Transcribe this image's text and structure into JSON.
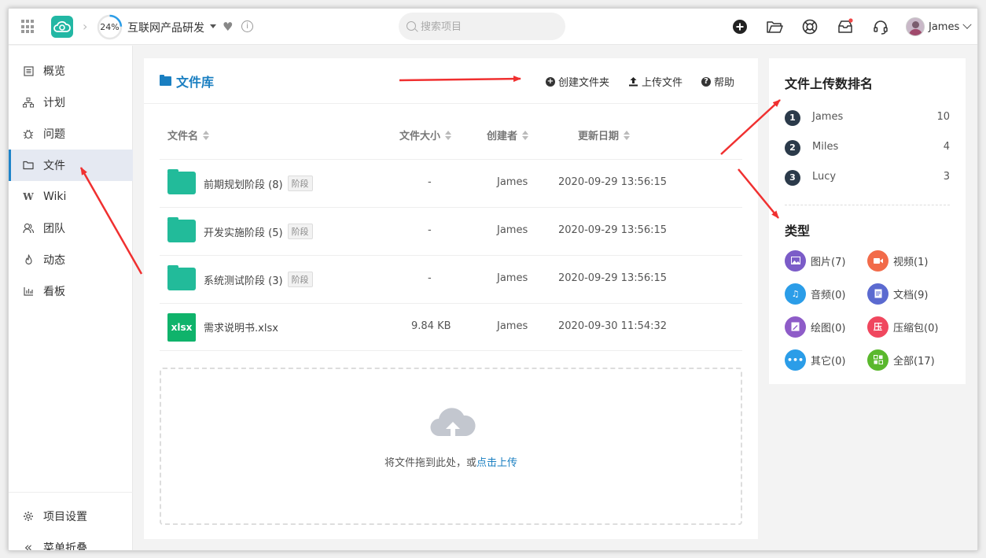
{
  "header": {
    "progress_text": "24%",
    "progress_value": 0.24,
    "project_name": "互联网产品研发",
    "search_placeholder": "搜索项目",
    "user_name": "James"
  },
  "sidebar": {
    "items": [
      {
        "label": "概览",
        "icon": "overview-icon"
      },
      {
        "label": "计划",
        "icon": "plan-icon"
      },
      {
        "label": "问题",
        "icon": "bug-icon"
      },
      {
        "label": "文件",
        "icon": "folder-icon"
      },
      {
        "label": "Wiki",
        "icon": "wiki-icon"
      },
      {
        "label": "团队",
        "icon": "team-icon"
      },
      {
        "label": "动态",
        "icon": "activity-icon"
      },
      {
        "label": "看板",
        "icon": "kanban-icon"
      }
    ],
    "settings_label": "项目设置",
    "collapse_label": "菜单折叠"
  },
  "main": {
    "title": "文件库",
    "actions": {
      "create_folder": "创建文件夹",
      "upload": "上传文件",
      "help": "帮助"
    },
    "columns": {
      "name": "文件名",
      "size": "文件大小",
      "creator": "创建者",
      "date": "更新日期"
    },
    "rows": [
      {
        "type": "folder",
        "name": "前期规划阶段 (8)",
        "badge": "阶段",
        "size": "-",
        "creator": "James",
        "date": "2020-09-29 13:56:15"
      },
      {
        "type": "folder",
        "name": "开发实施阶段 (5)",
        "badge": "阶段",
        "size": "-",
        "creator": "James",
        "date": "2020-09-29 13:56:15"
      },
      {
        "type": "folder",
        "name": "系统测试阶段 (3)",
        "badge": "阶段",
        "size": "-",
        "creator": "James",
        "date": "2020-09-29 13:56:15"
      },
      {
        "type": "xlsx",
        "icon_text": "xlsx",
        "name": "需求说明书.xlsx",
        "badge": "",
        "size": "9.84 KB",
        "creator": "James",
        "date": "2020-09-30 11:54:32"
      }
    ],
    "dropzone": {
      "text": "将文件拖到此处，或",
      "link": "点击上传"
    }
  },
  "right": {
    "rank_title": "文件上传数排名",
    "ranking": [
      {
        "rank": "1",
        "name": "James",
        "count": "10"
      },
      {
        "rank": "2",
        "name": "Miles",
        "count": "4"
      },
      {
        "rank": "3",
        "name": "Lucy",
        "count": "3"
      }
    ],
    "type_title": "类型",
    "types": [
      {
        "label": "图片(7)",
        "icon": "image-icon",
        "color": "#7b5cc8"
      },
      {
        "label": "视频(1)",
        "icon": "video-icon",
        "color": "#f26b4a"
      },
      {
        "label": "音频(0)",
        "icon": "audio-icon",
        "color": "#2b9de8"
      },
      {
        "label": "文档(9)",
        "icon": "document-icon",
        "color": "#5b6ad0"
      },
      {
        "label": "绘图(0)",
        "icon": "drawing-icon",
        "color": "#8e5cc8"
      },
      {
        "label": "压缩包(0)",
        "icon": "archive-icon",
        "color": "#f0475e",
        "glyph": "压"
      },
      {
        "label": "其它(0)",
        "icon": "other-icon",
        "color": "#2b9de8"
      },
      {
        "label": "全部(17)",
        "icon": "all-icon",
        "color": "#5ab82d"
      }
    ]
  },
  "colors": {
    "accent": "#1a7fc1",
    "folder_green": "#22bb9a",
    "logo": "#22b7a4",
    "annotation_arrow": "#f03030"
  }
}
